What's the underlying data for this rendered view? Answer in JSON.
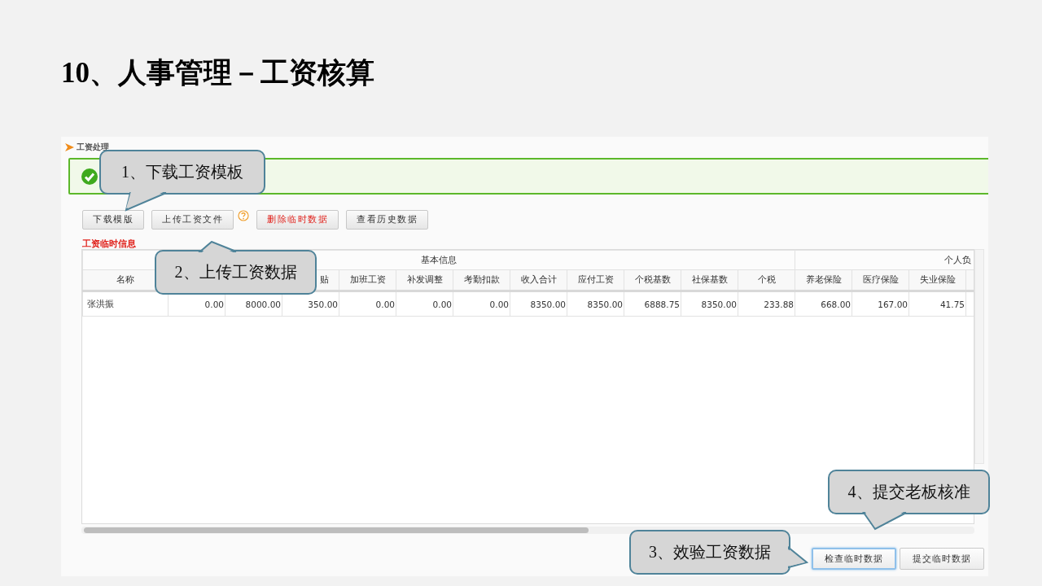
{
  "slide_title": "10、人事管理－工资核算",
  "page": {
    "breadcrumb": "工资处理",
    "toolbar": [
      {
        "label": "下载模版",
        "kind": "normal"
      },
      {
        "label": "上传工资文件",
        "kind": "normal"
      },
      {
        "kind": "help"
      },
      {
        "label": "删除临时数据",
        "kind": "danger"
      },
      {
        "label": "查看历史数据",
        "kind": "normal"
      }
    ],
    "section_title": "工资临时信息",
    "table": {
      "groups": [
        {
          "label": "基本信息",
          "columns": [
            {
              "header": "名称"
            },
            {},
            {},
            {
              "header": "贴"
            },
            {
              "header": "加班工资"
            },
            {
              "header": "补发调整"
            },
            {
              "header": "考勤扣款"
            },
            {
              "header": "收入合计"
            },
            {
              "header": "应付工资"
            },
            {
              "header": "个税基数"
            },
            {
              "header": "社保基数"
            },
            {
              "header": "个税"
            }
          ]
        },
        {
          "label": "个人负",
          "columns": [
            {
              "header": "养老保险"
            },
            {
              "header": "医疗保险"
            },
            {
              "header": "失业保险"
            }
          ]
        }
      ],
      "rows": [
        {
          "cells": [
            "张洪振",
            "0.00",
            "8000.00",
            "350.00",
            "0.00",
            "0.00",
            "0.00",
            "8350.00",
            "8350.00",
            "6888.75",
            "8350.00",
            "233.88",
            "668.00",
            "167.00",
            "41.75"
          ]
        }
      ]
    },
    "actions": [
      {
        "label": "检查临时数据",
        "focused": true
      },
      {
        "label": "提交临时数据",
        "focused": false
      }
    ]
  },
  "callouts": [
    {
      "text": "1、下载工资模板"
    },
    {
      "text": "2、上传工资数据"
    },
    {
      "text": "3、效验工资数据"
    },
    {
      "text": "4、提交老板核准"
    }
  ]
}
